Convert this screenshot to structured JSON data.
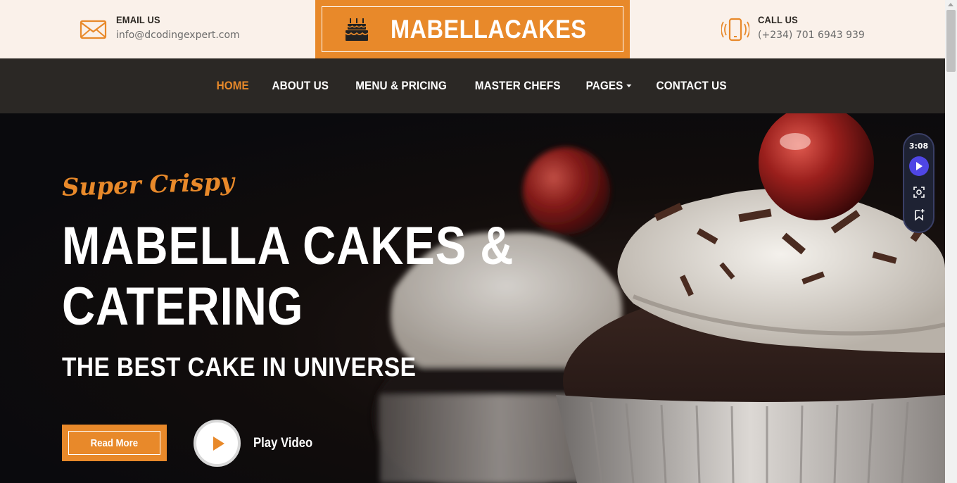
{
  "topbar": {
    "email": {
      "label": "EMAIL US",
      "value": "info@dcodingexpert.com",
      "icon": "envelope-icon"
    },
    "brand": {
      "name": "MABELLACAKES",
      "icon": "birthday-cake-icon"
    },
    "call": {
      "label": "CALL US",
      "value": "(+234) 701 6943 939",
      "icon": "mobile-phone-icon"
    }
  },
  "nav": {
    "items": [
      {
        "label": "HOME",
        "active": true
      },
      {
        "label": "ABOUT US"
      },
      {
        "label": "MENU & PRICING"
      },
      {
        "label": "MASTER CHEFS"
      },
      {
        "label": "PAGES",
        "dropdown": true
      },
      {
        "label": "CONTACT US"
      }
    ]
  },
  "hero": {
    "kicker": "Super Crispy",
    "title_line1": "MABELLA CAKES &",
    "title_line2": "CATERING",
    "subtitle": "THE BEST CAKE IN UNIVERSE",
    "read_more": "Read More",
    "play_video": "Play Video",
    "image": "cupcakes-with-cherry-and-chocolate-shavings"
  },
  "widget": {
    "time": "3:08",
    "icons": [
      "play-icon",
      "screenshot-icon",
      "add-bookmark-icon"
    ]
  },
  "colors": {
    "accent": "#e8892a",
    "nav_bg": "#2b2825",
    "topbar_bg": "#faf1ea"
  }
}
